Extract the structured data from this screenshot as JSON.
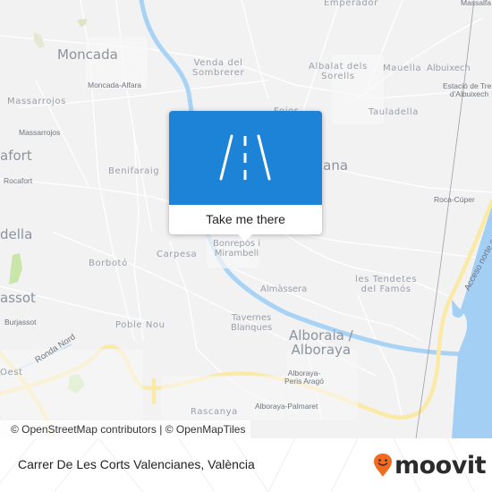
{
  "map": {
    "colors": {
      "land": "#f2f2f3",
      "water": "#a9d3f5",
      "sea": "#a3cff5",
      "major_road": "#fbe9a6",
      "park": "#c9e6a8"
    },
    "places": [
      {
        "id": "emperador",
        "label": "Emperador",
        "size": "mid"
      },
      {
        "id": "moncada",
        "label": "Moncada",
        "size": "big"
      },
      {
        "id": "venda-del-sombrerer",
        "label": "Venda del\nSombrerer",
        "size": "mid"
      },
      {
        "id": "albalat-dels-sorells",
        "label": "Albalat dels\nSorells",
        "size": "mid"
      },
      {
        "id": "mauella",
        "label": "Mauella",
        "size": "mid"
      },
      {
        "id": "albuixech",
        "label": "Albuixech",
        "size": "mid"
      },
      {
        "id": "moncada-alfara",
        "label": "Moncada-Alfara",
        "size": "small"
      },
      {
        "id": "estacio-albuixech",
        "label": "Estació de Tren\nd'Albuixech",
        "size": "small"
      },
      {
        "id": "massarrojos-area",
        "label": "Massarrojos",
        "size": "mid"
      },
      {
        "id": "massarrojos-stop",
        "label": "Massarrojos",
        "size": "small"
      },
      {
        "id": "tauladella",
        "label": "Tauladella",
        "size": "mid"
      },
      {
        "id": "foios",
        "label": "Foios",
        "size": "mid"
      },
      {
        "id": "rocafort-area",
        "label": "afort",
        "size": "big"
      },
      {
        "id": "rocafort-stop",
        "label": "Rocafort",
        "size": "small"
      },
      {
        "id": "benifaraig",
        "label": "Benifaraig",
        "size": "mid"
      },
      {
        "id": "meliana",
        "label": "iana",
        "size": "big"
      },
      {
        "id": "roca-cuper",
        "label": "Roca-Cúper",
        "size": "small"
      },
      {
        "id": "godella",
        "label": "della",
        "size": "big"
      },
      {
        "id": "carpesa",
        "label": "Carpesa",
        "size": "mid"
      },
      {
        "id": "bonrepos",
        "label": "Bonrepòs i\nMirambell",
        "size": "mid"
      },
      {
        "id": "borboto",
        "label": "Borbotó",
        "size": "mid"
      },
      {
        "id": "les-tendetes",
        "label": "les Tendetes\ndel Famós",
        "size": "mid"
      },
      {
        "id": "almassera",
        "label": "Almàssera",
        "size": "mid"
      },
      {
        "id": "burjassot-area",
        "label": "assot",
        "size": "big"
      },
      {
        "id": "burjassot-stop",
        "label": "Burjassot",
        "size": "small"
      },
      {
        "id": "poble-nou",
        "label": "Poble Nou",
        "size": "mid"
      },
      {
        "id": "tavernes-blanques",
        "label": "Tavernes\nBlanques",
        "size": "mid"
      },
      {
        "id": "alboraia",
        "label": "Alboraia /\nAlboraya",
        "size": "big"
      },
      {
        "id": "oest",
        "label": "Oest",
        "size": "mid"
      },
      {
        "id": "alboraya-peris-arago",
        "label": "Alboraya-\nPeris Aragó",
        "size": "small"
      },
      {
        "id": "rascanya",
        "label": "Rascanya",
        "size": "mid"
      },
      {
        "id": "alboraya-palmaret",
        "label": "Alboraya-Palmaret",
        "size": "small"
      },
      {
        "id": "massalfassar",
        "label": "Massalfa",
        "size": "small"
      }
    ],
    "roads": [
      {
        "id": "ronda-nord",
        "label": "Ronda Nord"
      },
      {
        "id": "acceso-norte",
        "label": "Acceso norte a Val"
      }
    ]
  },
  "popup": {
    "icon": "road-icon",
    "cta_label": "Take me there",
    "header_color": "#1d83d7"
  },
  "attribution": {
    "text": "© OpenStreetMap contributors | © OpenMapTiles"
  },
  "footer": {
    "address": "Carrer De Les Corts Valencianes, València",
    "brand": {
      "name": "moovit",
      "icon": "moovit-pin-icon",
      "pin_color": "#f26b21"
    }
  }
}
